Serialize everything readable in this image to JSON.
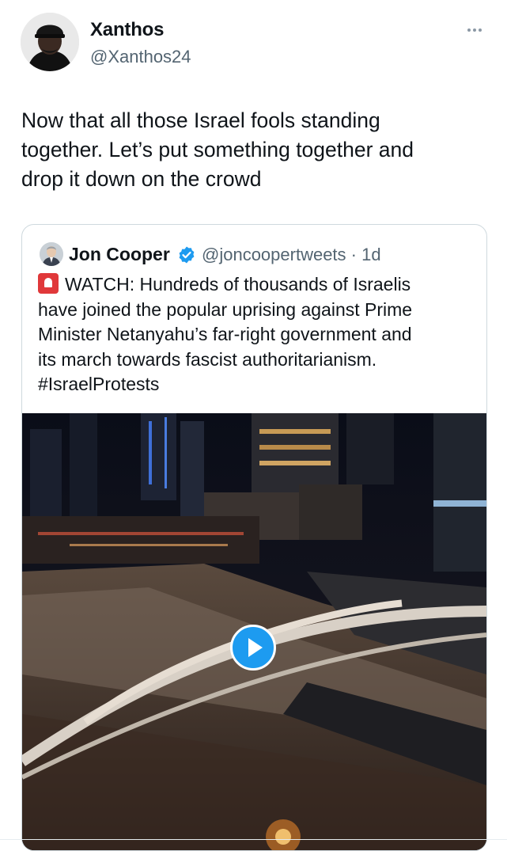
{
  "author": {
    "name": "Xanthos",
    "handle": "@Xanthos24"
  },
  "tweet": {
    "text_lines": [
      "Now that all those Israel fools standing",
      "together. Let’s put something together and",
      "drop it down on the crowd"
    ]
  },
  "quoted": {
    "name": "Jon Cooper",
    "handle_time": "@joncoopertweets · 1d",
    "text_line_1": "WATCH: Hundreds of thousands of Israelis",
    "text_lines": [
      "have joined the popular uprising against Prime",
      "Minister Netanyahu’s far-right government and",
      "its march towards fascist authoritarianism.",
      "#IsraelProtests"
    ]
  },
  "icons": {
    "more": "more-icon",
    "verified": "verified-badge-icon",
    "alert": "siren-emoji-icon",
    "play": "play-icon"
  },
  "colors": {
    "accent": "#1d9bf0",
    "secondary_text": "#536471",
    "siren": "#e0383a"
  }
}
